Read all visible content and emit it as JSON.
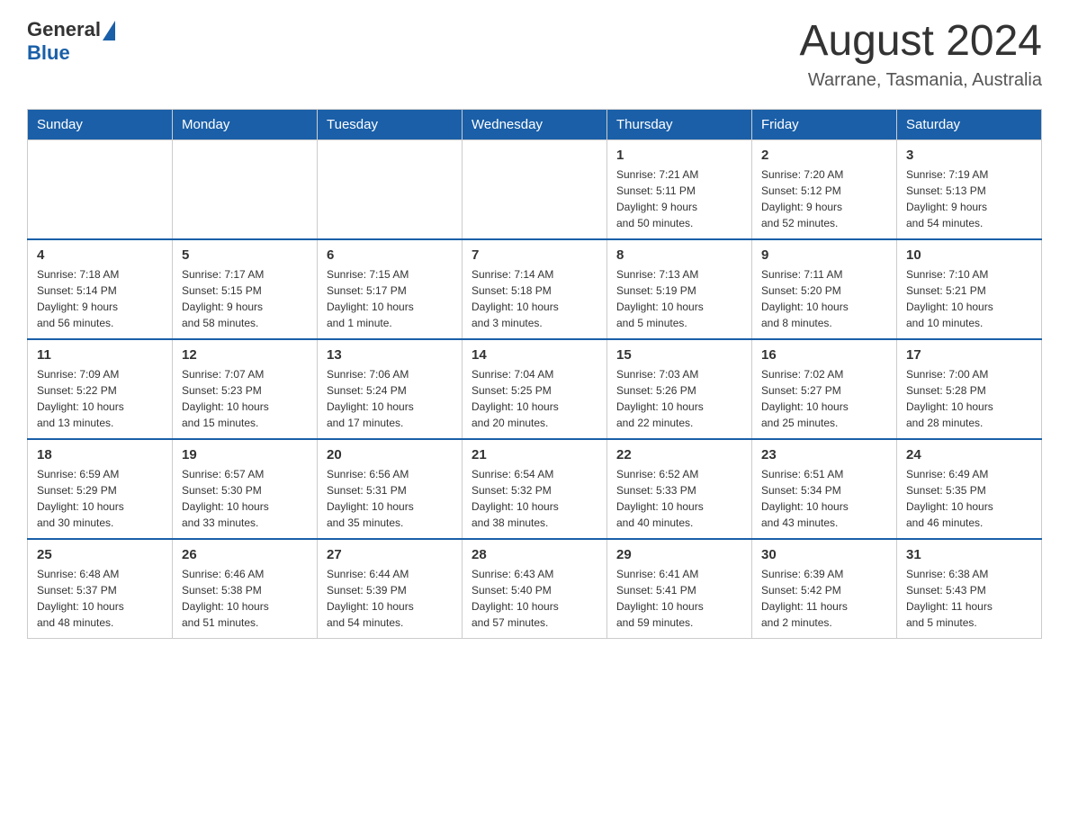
{
  "header": {
    "logo_general": "General",
    "logo_blue": "Blue",
    "month_title": "August 2024",
    "location": "Warrane, Tasmania, Australia"
  },
  "days_of_week": [
    "Sunday",
    "Monday",
    "Tuesday",
    "Wednesday",
    "Thursday",
    "Friday",
    "Saturday"
  ],
  "weeks": [
    [
      {
        "day": "",
        "info": ""
      },
      {
        "day": "",
        "info": ""
      },
      {
        "day": "",
        "info": ""
      },
      {
        "day": "",
        "info": ""
      },
      {
        "day": "1",
        "info": "Sunrise: 7:21 AM\nSunset: 5:11 PM\nDaylight: 9 hours\nand 50 minutes."
      },
      {
        "day": "2",
        "info": "Sunrise: 7:20 AM\nSunset: 5:12 PM\nDaylight: 9 hours\nand 52 minutes."
      },
      {
        "day": "3",
        "info": "Sunrise: 7:19 AM\nSunset: 5:13 PM\nDaylight: 9 hours\nand 54 minutes."
      }
    ],
    [
      {
        "day": "4",
        "info": "Sunrise: 7:18 AM\nSunset: 5:14 PM\nDaylight: 9 hours\nand 56 minutes."
      },
      {
        "day": "5",
        "info": "Sunrise: 7:17 AM\nSunset: 5:15 PM\nDaylight: 9 hours\nand 58 minutes."
      },
      {
        "day": "6",
        "info": "Sunrise: 7:15 AM\nSunset: 5:17 PM\nDaylight: 10 hours\nand 1 minute."
      },
      {
        "day": "7",
        "info": "Sunrise: 7:14 AM\nSunset: 5:18 PM\nDaylight: 10 hours\nand 3 minutes."
      },
      {
        "day": "8",
        "info": "Sunrise: 7:13 AM\nSunset: 5:19 PM\nDaylight: 10 hours\nand 5 minutes."
      },
      {
        "day": "9",
        "info": "Sunrise: 7:11 AM\nSunset: 5:20 PM\nDaylight: 10 hours\nand 8 minutes."
      },
      {
        "day": "10",
        "info": "Sunrise: 7:10 AM\nSunset: 5:21 PM\nDaylight: 10 hours\nand 10 minutes."
      }
    ],
    [
      {
        "day": "11",
        "info": "Sunrise: 7:09 AM\nSunset: 5:22 PM\nDaylight: 10 hours\nand 13 minutes."
      },
      {
        "day": "12",
        "info": "Sunrise: 7:07 AM\nSunset: 5:23 PM\nDaylight: 10 hours\nand 15 minutes."
      },
      {
        "day": "13",
        "info": "Sunrise: 7:06 AM\nSunset: 5:24 PM\nDaylight: 10 hours\nand 17 minutes."
      },
      {
        "day": "14",
        "info": "Sunrise: 7:04 AM\nSunset: 5:25 PM\nDaylight: 10 hours\nand 20 minutes."
      },
      {
        "day": "15",
        "info": "Sunrise: 7:03 AM\nSunset: 5:26 PM\nDaylight: 10 hours\nand 22 minutes."
      },
      {
        "day": "16",
        "info": "Sunrise: 7:02 AM\nSunset: 5:27 PM\nDaylight: 10 hours\nand 25 minutes."
      },
      {
        "day": "17",
        "info": "Sunrise: 7:00 AM\nSunset: 5:28 PM\nDaylight: 10 hours\nand 28 minutes."
      }
    ],
    [
      {
        "day": "18",
        "info": "Sunrise: 6:59 AM\nSunset: 5:29 PM\nDaylight: 10 hours\nand 30 minutes."
      },
      {
        "day": "19",
        "info": "Sunrise: 6:57 AM\nSunset: 5:30 PM\nDaylight: 10 hours\nand 33 minutes."
      },
      {
        "day": "20",
        "info": "Sunrise: 6:56 AM\nSunset: 5:31 PM\nDaylight: 10 hours\nand 35 minutes."
      },
      {
        "day": "21",
        "info": "Sunrise: 6:54 AM\nSunset: 5:32 PM\nDaylight: 10 hours\nand 38 minutes."
      },
      {
        "day": "22",
        "info": "Sunrise: 6:52 AM\nSunset: 5:33 PM\nDaylight: 10 hours\nand 40 minutes."
      },
      {
        "day": "23",
        "info": "Sunrise: 6:51 AM\nSunset: 5:34 PM\nDaylight: 10 hours\nand 43 minutes."
      },
      {
        "day": "24",
        "info": "Sunrise: 6:49 AM\nSunset: 5:35 PM\nDaylight: 10 hours\nand 46 minutes."
      }
    ],
    [
      {
        "day": "25",
        "info": "Sunrise: 6:48 AM\nSunset: 5:37 PM\nDaylight: 10 hours\nand 48 minutes."
      },
      {
        "day": "26",
        "info": "Sunrise: 6:46 AM\nSunset: 5:38 PM\nDaylight: 10 hours\nand 51 minutes."
      },
      {
        "day": "27",
        "info": "Sunrise: 6:44 AM\nSunset: 5:39 PM\nDaylight: 10 hours\nand 54 minutes."
      },
      {
        "day": "28",
        "info": "Sunrise: 6:43 AM\nSunset: 5:40 PM\nDaylight: 10 hours\nand 57 minutes."
      },
      {
        "day": "29",
        "info": "Sunrise: 6:41 AM\nSunset: 5:41 PM\nDaylight: 10 hours\nand 59 minutes."
      },
      {
        "day": "30",
        "info": "Sunrise: 6:39 AM\nSunset: 5:42 PM\nDaylight: 11 hours\nand 2 minutes."
      },
      {
        "day": "31",
        "info": "Sunrise: 6:38 AM\nSunset: 5:43 PM\nDaylight: 11 hours\nand 5 minutes."
      }
    ]
  ]
}
